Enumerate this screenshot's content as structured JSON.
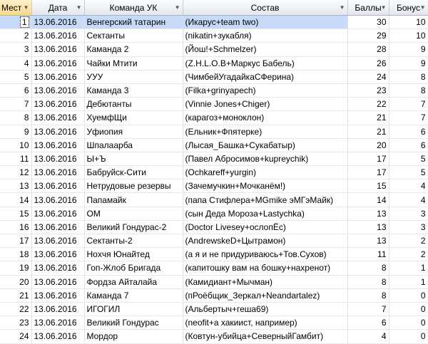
{
  "headers": [
    "Мест",
    "Дата",
    "Команда УК",
    "Состав",
    "Баллы",
    "Бонус"
  ],
  "rows": [
    {
      "place": "1",
      "date": "13.06.2016",
      "team": "Венгерский татарин",
      "members": "(Икарус+team two)",
      "points": "30",
      "bonus": "10"
    },
    {
      "place": "2",
      "date": "13.06.2016",
      "team": "Сектанты",
      "members": "(nikatin+зукабля)",
      "points": "29",
      "bonus": "10"
    },
    {
      "place": "3",
      "date": "13.06.2016",
      "team": "Каманда 2",
      "members": "(Йош!+Schmelzer)",
      "points": "28",
      "bonus": "9"
    },
    {
      "place": "4",
      "date": "13.06.2016",
      "team": "Чайки Мтити",
      "members": "(Z.H.L.O.B+Маркус Бабель)",
      "points": "26",
      "bonus": "9"
    },
    {
      "place": "5",
      "date": "13.06.2016",
      "team": "УУУ",
      "members": "(ЧимбейУгадайкаСФерина)",
      "points": "24",
      "bonus": "8"
    },
    {
      "place": "6",
      "date": "13.06.2016",
      "team": "Каманда 3",
      "members": "(Filka+grinyapech)",
      "points": "23",
      "bonus": "8"
    },
    {
      "place": "7",
      "date": "13.06.2016",
      "team": "Дебютанты",
      "members": "(Vinnie Jones+Chiger)",
      "points": "22",
      "bonus": "7"
    },
    {
      "place": "8",
      "date": "13.06.2016",
      "team": "ХуемфЩи",
      "members": "(карагоз+моноклон)",
      "points": "21",
      "bonus": "7"
    },
    {
      "place": "9",
      "date": "13.06.2016",
      "team": "Уфиопия",
      "members": "(Ельник+Фпятерке)",
      "points": "21",
      "bonus": "6"
    },
    {
      "place": "10",
      "date": "13.06.2016",
      "team": "Шпалаарба",
      "members": "(Лысая_Башка+Сукабатыр)",
      "points": "20",
      "bonus": "6"
    },
    {
      "place": "11",
      "date": "13.06.2016",
      "team": "Ы+Ъ",
      "members": "(Павел Абросимов+kupreychik)",
      "points": "17",
      "bonus": "5"
    },
    {
      "place": "12",
      "date": "13.06.2016",
      "team": "Бабруйск-Сити",
      "members": "(Ochkareff+yurgin)",
      "points": "17",
      "bonus": "5"
    },
    {
      "place": "13",
      "date": "13.06.2016",
      "team": "Нетрудовые резервы",
      "members": "(Зачемучкин+Мочканём!)",
      "points": "15",
      "bonus": "4"
    },
    {
      "place": "14",
      "date": "13.06.2016",
      "team": "Папамайк",
      "members": "(папа Стифлера+MGmike эМГэМайк)",
      "points": "14",
      "bonus": "4"
    },
    {
      "place": "15",
      "date": "13.06.2016",
      "team": "ОМ",
      "members": "(сын Деда Мороза+Lastychka)",
      "points": "13",
      "bonus": "3"
    },
    {
      "place": "16",
      "date": "13.06.2016",
      "team": "Великий Гондурас-2",
      "members": "(Doctor Livesey+ослопЁс)",
      "points": "13",
      "bonus": "3"
    },
    {
      "place": "17",
      "date": "13.06.2016",
      "team": "Сектанты-2",
      "members": "(AndrewskeD+Цытрамон)",
      "points": "13",
      "bonus": "2"
    },
    {
      "place": "18",
      "date": "13.06.2016",
      "team": "Ноxчя Юнайтед",
      "members": "(а я и не придуриваюсь+Тов.Сухов)",
      "points": "11",
      "bonus": "2"
    },
    {
      "place": "19",
      "date": "13.06.2016",
      "team": "Гоп-Жлоб Бригада",
      "members": "(капитошку вам на бошку+нахренот)",
      "points": "8",
      "bonus": "1"
    },
    {
      "place": "20",
      "date": "13.06.2016",
      "team": "Фордза Айталайа",
      "members": "(Камидиант+Мычман)",
      "points": "8",
      "bonus": "1"
    },
    {
      "place": "21",
      "date": "13.06.2016",
      "team": "Каманда 7",
      "members": "(пРоёбщик_Зеркал+Neandartalez)",
      "points": "8",
      "bonus": "0"
    },
    {
      "place": "22",
      "date": "13.06.2016",
      "team": "ИГОГИЛ",
      "members": "(Альбертыч+геша69)",
      "points": "7",
      "bonus": "0"
    },
    {
      "place": "23",
      "date": "13.06.2016",
      "team": "Великий Гондурас",
      "members": "(neofit+а хакиист, например)",
      "points": "6",
      "bonus": "0"
    },
    {
      "place": "24",
      "date": "13.06.2016",
      "team": "Мордор",
      "members": "(Ковтун-убийца+СеверныйГамбит)",
      "points": "4",
      "bonus": "0"
    }
  ]
}
